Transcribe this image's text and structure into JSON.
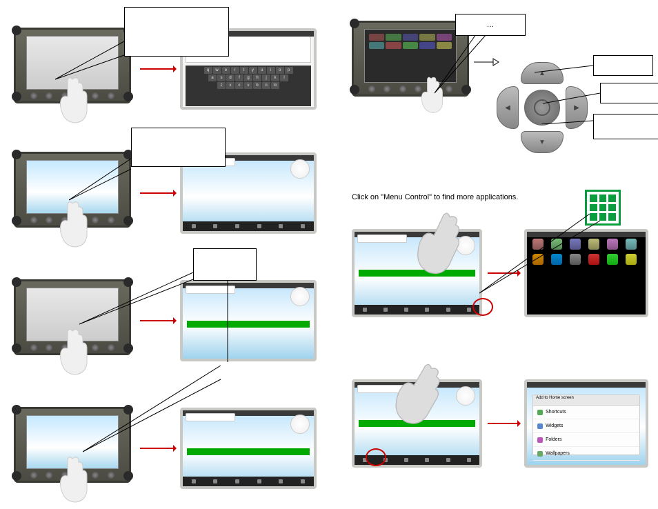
{
  "sections": {
    "menu_caption": "Click on \"Menu Control\" to find more applications.",
    "callout_ellipsis": "…"
  },
  "keyboard": {
    "rows": [
      [
        "q",
        "w",
        "e",
        "r",
        "t",
        "y",
        "u",
        "i",
        "o",
        "p"
      ],
      [
        "a",
        "s",
        "d",
        "f",
        "g",
        "h",
        "j",
        "k",
        "l"
      ],
      [
        "z",
        "x",
        "c",
        "v",
        "b",
        "n",
        "m"
      ]
    ]
  },
  "menu_items": [
    "Shortcuts",
    "Widgets",
    "Folders",
    "Wallpapers"
  ],
  "menu_header": "Add to Home screen"
}
